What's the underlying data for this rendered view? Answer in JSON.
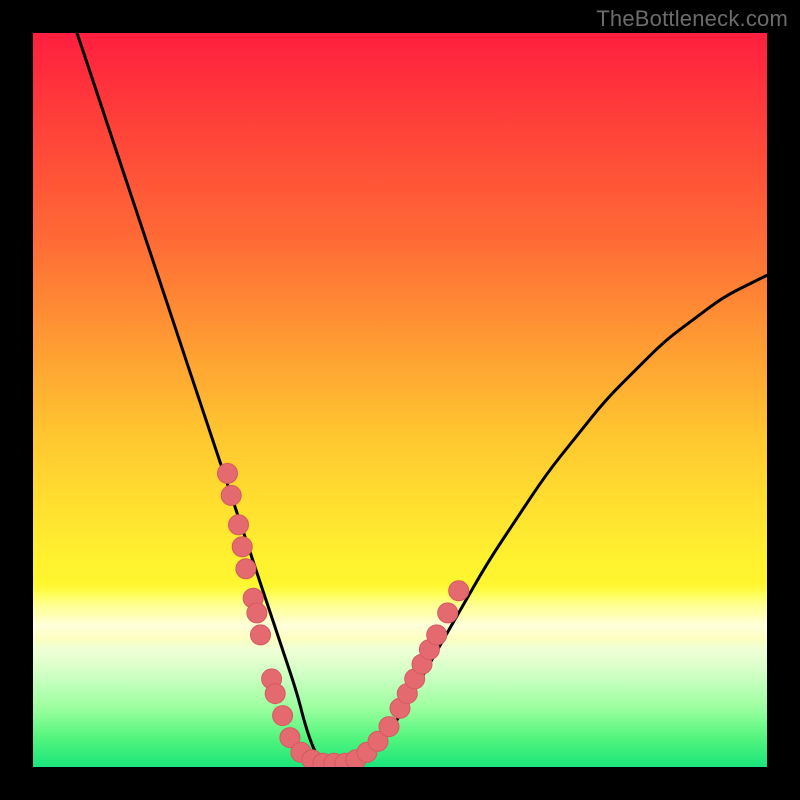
{
  "watermark": "TheBottleneck.com",
  "colors": {
    "curve": "#000000",
    "marker_fill": "#e46a6f",
    "marker_stroke": "#d45a60"
  },
  "chart_data": {
    "type": "line",
    "title": "",
    "xlabel": "",
    "ylabel": "",
    "xlim": [
      0,
      100
    ],
    "ylim": [
      0,
      100
    ],
    "series": [
      {
        "name": "bottleneck-curve",
        "x": [
          6,
          8,
          10,
          12,
          14,
          16,
          18,
          20,
          22,
          24,
          26,
          28,
          30,
          32,
          34,
          36,
          37,
          38,
          39,
          40,
          42,
          44,
          46,
          48,
          50,
          54,
          58,
          62,
          66,
          70,
          74,
          78,
          82,
          86,
          90,
          94,
          98,
          100
        ],
        "y": [
          100,
          94,
          88,
          82,
          76,
          70,
          64,
          58,
          52,
          46,
          40,
          34,
          28,
          22,
          16,
          10,
          6,
          3,
          1,
          0.5,
          0.5,
          1,
          2,
          4,
          7,
          14,
          21,
          28,
          34,
          40,
          45,
          50,
          54,
          58,
          61,
          64,
          66,
          67
        ]
      }
    ],
    "markers": {
      "name": "highlighted-points",
      "points": [
        {
          "x": 26.5,
          "y": 40
        },
        {
          "x": 27.0,
          "y": 37
        },
        {
          "x": 28.0,
          "y": 33
        },
        {
          "x": 28.5,
          "y": 30
        },
        {
          "x": 29.0,
          "y": 27
        },
        {
          "x": 30.0,
          "y": 23
        },
        {
          "x": 30.5,
          "y": 21
        },
        {
          "x": 31.0,
          "y": 18
        },
        {
          "x": 32.5,
          "y": 12
        },
        {
          "x": 33.0,
          "y": 10
        },
        {
          "x": 34.0,
          "y": 7
        },
        {
          "x": 35.0,
          "y": 4
        },
        {
          "x": 36.5,
          "y": 2
        },
        {
          "x": 38.0,
          "y": 1
        },
        {
          "x": 39.5,
          "y": 0.5
        },
        {
          "x": 41.0,
          "y": 0.5
        },
        {
          "x": 42.5,
          "y": 0.5
        },
        {
          "x": 44.0,
          "y": 1
        },
        {
          "x": 45.5,
          "y": 2
        },
        {
          "x": 47.0,
          "y": 3.5
        },
        {
          "x": 48.5,
          "y": 5.5
        },
        {
          "x": 50.0,
          "y": 8
        },
        {
          "x": 51.0,
          "y": 10
        },
        {
          "x": 52.0,
          "y": 12
        },
        {
          "x": 53.0,
          "y": 14
        },
        {
          "x": 54.0,
          "y": 16
        },
        {
          "x": 55.0,
          "y": 18
        },
        {
          "x": 56.5,
          "y": 21
        },
        {
          "x": 58.0,
          "y": 24
        }
      ]
    }
  }
}
